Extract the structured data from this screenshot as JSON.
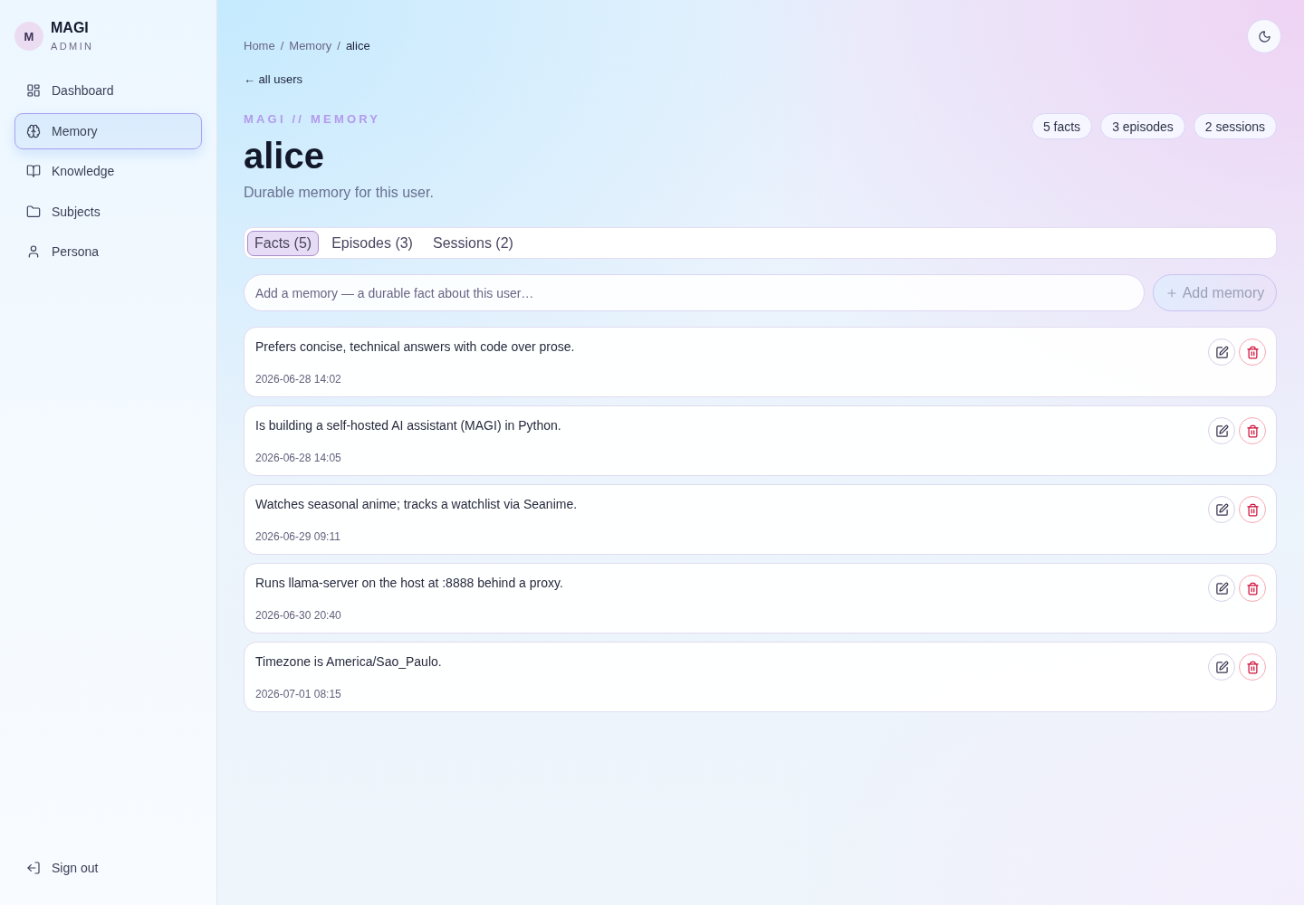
{
  "sidebar": {
    "brand": {
      "avatar_letter": "M",
      "name": "MAGI",
      "role": "ADMIN"
    },
    "items": [
      {
        "label": "Dashboard",
        "selected": false
      },
      {
        "label": "Memory",
        "selected": true
      },
      {
        "label": "Knowledge",
        "selected": false
      },
      {
        "label": "Subjects",
        "selected": false
      },
      {
        "label": "Persona",
        "selected": false
      }
    ],
    "sign_out": {
      "label": "Sign out"
    }
  },
  "breadcrumb": [
    {
      "kind": "link",
      "label": "Home",
      "current": false
    },
    {
      "kind": "separator",
      "label": "/"
    },
    {
      "kind": "link",
      "label": "Memory",
      "current": false
    },
    {
      "kind": "separator",
      "label": "/"
    },
    {
      "kind": "link",
      "label": "alice",
      "current": true
    }
  ],
  "back_link": "← all users",
  "header": {
    "eyebrow": "MAGI // MEMORY",
    "title": "alice",
    "subtitle": "Durable memory for this user."
  },
  "stats": [
    "5 facts",
    "3 episodes",
    "2 sessions"
  ],
  "tabs": [
    {
      "label": "Facts (5)",
      "selected": true
    },
    {
      "label": "Episodes (3)",
      "selected": false
    },
    {
      "label": "Sessions (2)",
      "selected": false
    }
  ],
  "add_form": {
    "placeholder": "Add a memory — a durable fact about this user…",
    "button": {
      "label": "Add memory",
      "disabled": true
    }
  },
  "facts": [
    {
      "text": "Prefers concise, technical answers with code over prose.",
      "date": "2026-06-28 14:02"
    },
    {
      "text": "Is building a self-hosted AI assistant (MAGI) in Python.",
      "date": "2026-06-28 14:05"
    },
    {
      "text": "Watches seasonal anime; tracks a watchlist via Seanime.",
      "date": "2026-06-29 09:11"
    },
    {
      "text": "Runs llama-server on the host at :8888 behind a proxy.",
      "date": "2026-06-30 20:40"
    },
    {
      "text": "Timezone is America/Sao_Paulo.",
      "date": "2026-07-01 08:15"
    }
  ]
}
